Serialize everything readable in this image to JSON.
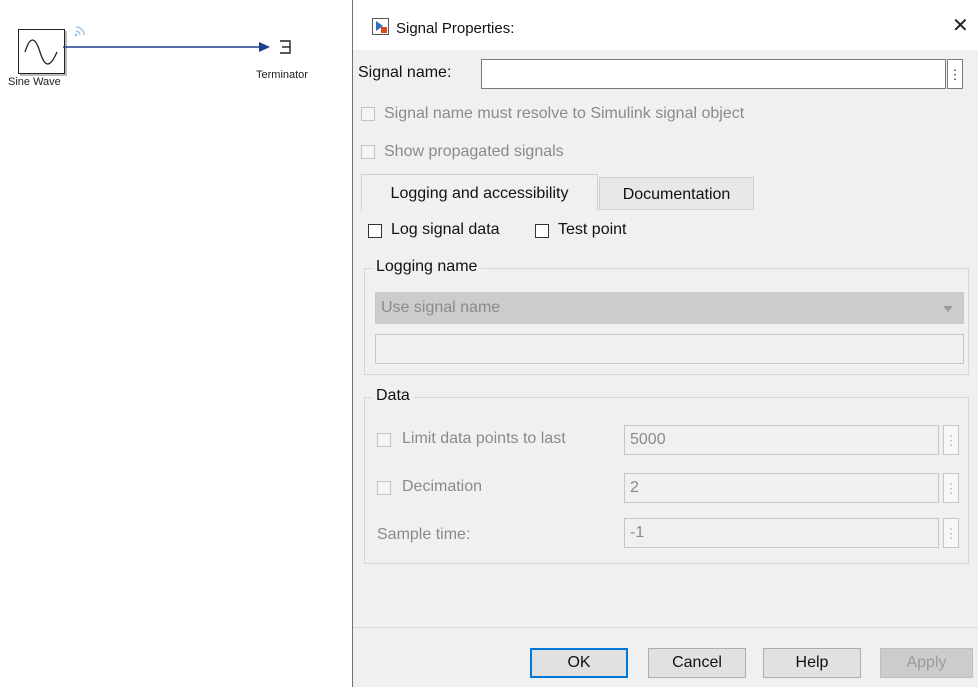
{
  "canvas": {
    "blocks": [
      {
        "label": "Sine Wave"
      },
      {
        "label": "Terminator"
      }
    ]
  },
  "dialog": {
    "title": "Signal Properties:",
    "close_glyph": "✕",
    "signal_name_label": "Signal name:",
    "signal_name_value": "",
    "resolve_checkbox_label": "Signal name must resolve to Simulink signal object",
    "propagated_checkbox_label": "Show propagated signals",
    "tabs": [
      {
        "label": "Logging and accessibility",
        "active": true
      },
      {
        "label": "Documentation",
        "active": false
      }
    ],
    "log_signal_data_label": "Log signal data",
    "test_point_label": "Test point",
    "logging_name": {
      "legend": "Logging name",
      "dropdown_value": "Use signal name",
      "text_value": ""
    },
    "data_group": {
      "legend": "Data",
      "limit_label": "Limit data points to last",
      "limit_value": "5000",
      "decimation_label": "Decimation",
      "decimation_value": "2",
      "sample_time_label": "Sample time:",
      "sample_time_value": "-1"
    },
    "buttons": {
      "ok": "OK",
      "cancel": "Cancel",
      "help": "Help",
      "apply": "Apply"
    }
  },
  "icons": {
    "more_options": "⋮",
    "sine_wave": "sine-wave-icon",
    "terminator": "terminator-icon",
    "signal_wifi": "signal-logging-icon",
    "dialog_icon": "simulink-block-icon"
  },
  "colors": {
    "accent": "#0078d7",
    "signal_line": "#1f3f8f",
    "wifi_badge": "#9ec7ea",
    "dialog_bg": "#f0f0f0"
  }
}
